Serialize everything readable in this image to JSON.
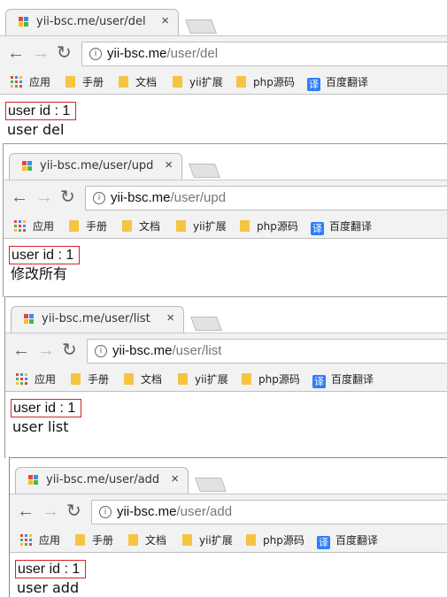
{
  "favicon_colors": [
    "#e8453c",
    "#3b8eea",
    "#f9bb2d",
    "#4fb24a"
  ],
  "windows": [
    {
      "tab_title": "yii-bsc.me/user/del",
      "url_host": "yii-bsc.me",
      "url_path": "/user/del",
      "user_id_text": "user id : 1",
      "user_text": "user del"
    },
    {
      "tab_title": "yii-bsc.me/user/upd",
      "url_host": "yii-bsc.me",
      "url_path": "/user/upd",
      "user_id_text": "user id : 1",
      "user_text": "修改所有"
    },
    {
      "tab_title": "yii-bsc.me/user/list",
      "url_host": "yii-bsc.me",
      "url_path": "/user/list",
      "user_id_text": "user id : 1",
      "user_text": "user list"
    },
    {
      "tab_title": "yii-bsc.me/user/add",
      "url_host": "yii-bsc.me",
      "url_path": "/user/add",
      "user_id_text": "user id : 1",
      "user_text": "user add"
    }
  ],
  "bookmarks": {
    "apps": "应用",
    "manual": "手册",
    "docs": "文档",
    "yii_ext": "yii扩展",
    "php_src": "php源码",
    "translate_badge": "译",
    "translate": "百度翻译"
  },
  "icons": {
    "tab_close": "×",
    "back": "←",
    "forward": "→",
    "reload": "↻",
    "info": "i"
  }
}
